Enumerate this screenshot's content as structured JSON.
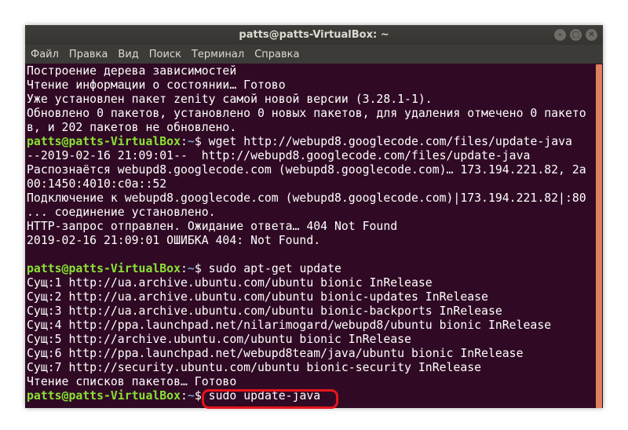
{
  "window": {
    "title": "patts@patts-VirtualBox: ~",
    "buttons": [
      "–",
      "□",
      "✕"
    ]
  },
  "menu": [
    "Файл",
    "Правка",
    "Вид",
    "Поиск",
    "Терминал",
    "Справка"
  ],
  "prompt": {
    "user": "patts@patts-VirtualBox",
    "path": "~",
    "symbol": "$"
  },
  "lines": [
    {
      "text": "Построение дерева зависимостей"
    },
    {
      "text": "Чтение информации о состоянии… Готово"
    },
    {
      "text": "Уже установлен пакет zenity самой новой версии (3.28.1-1)."
    },
    {
      "text": "Обновлено 0 пакетов, установлено 0 новых пакетов, для удаления отмечено 0 пакето"
    },
    {
      "text": "в, и 202 пакетов не обновлено."
    },
    {
      "cmd": " wget http://webupd8.googlecode.com/files/update-java"
    },
    {
      "text": "--2019-02-16 21:09:01--  http://webupd8.googlecode.com/files/update-java"
    },
    {
      "text": "Распознаётся webupd8.googlecode.com (webupd8.googlecode.com)… 173.194.221.82, 2a"
    },
    {
      "text": "00:1450:4010:c0a::52"
    },
    {
      "text": "Подключение к webupd8.googlecode.com (webupd8.googlecode.com)|173.194.221.82|:80"
    },
    {
      "text": "... соединение установлено."
    },
    {
      "text": "HTTP-запрос отправлен. Ожидание ответа… 404 Not Found"
    },
    {
      "text": "2019-02-16 21:09:01 ОШИБКА 404: Not Found."
    },
    {
      "text": ""
    },
    {
      "cmd": " sudo apt-get update"
    },
    {
      "text": "Сущ:1 http://ua.archive.ubuntu.com/ubuntu bionic InRelease"
    },
    {
      "text": "Сущ:2 http://ua.archive.ubuntu.com/ubuntu bionic-updates InRelease"
    },
    {
      "text": "Сущ:3 http://ua.archive.ubuntu.com/ubuntu bionic-backports InRelease"
    },
    {
      "text": "Сущ:4 http://ppa.launchpad.net/nilarimogard/webupd8/ubuntu bionic InRelease"
    },
    {
      "text": "Сущ:5 http://archive.ubuntu.com/ubuntu bionic InRelease"
    },
    {
      "text": "Сущ:6 http://ppa.launchpad.net/webupd8team/java/ubuntu bionic InRelease"
    },
    {
      "text": "Сущ:7 http://security.ubuntu.com/ubuntu bionic-security InRelease"
    },
    {
      "text": "Чтение списков пакетов… Готово"
    },
    {
      "cmd": " sudo update-java"
    }
  ],
  "colors": {
    "background": "#300a24",
    "text": "#ffffff",
    "prompt_user": "#8ae234",
    "prompt_path": "#729fcf",
    "scrollbar": "#e07e60",
    "highlight": "#e8141c"
  }
}
